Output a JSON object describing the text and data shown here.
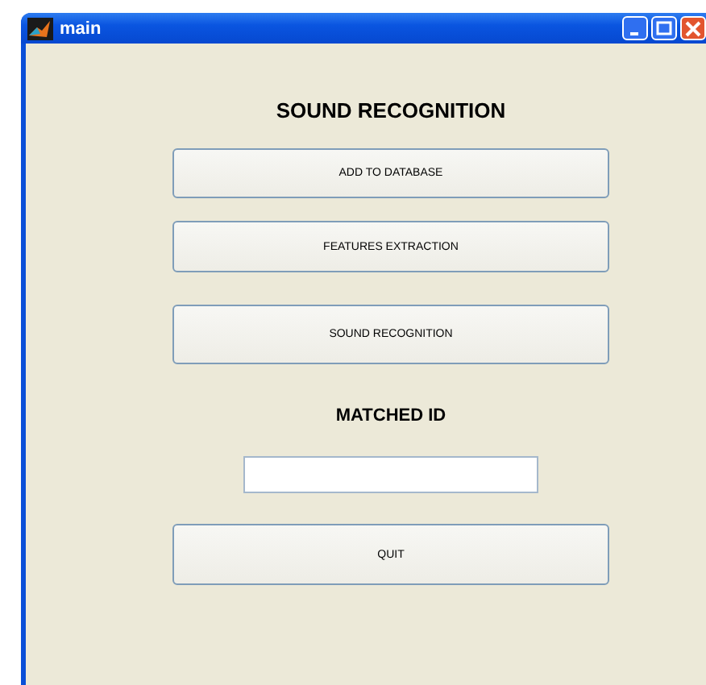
{
  "window": {
    "title": "main"
  },
  "heading": "SOUND RECOGNITION",
  "buttons": [
    {
      "label": "ADD TO DATABASE"
    },
    {
      "label": "FEATURES EXTRACTION"
    },
    {
      "label": "SOUND RECOGNITION"
    }
  ],
  "matched_label": "MATCHED ID",
  "quit_button": {
    "label": "QUIT"
  }
}
